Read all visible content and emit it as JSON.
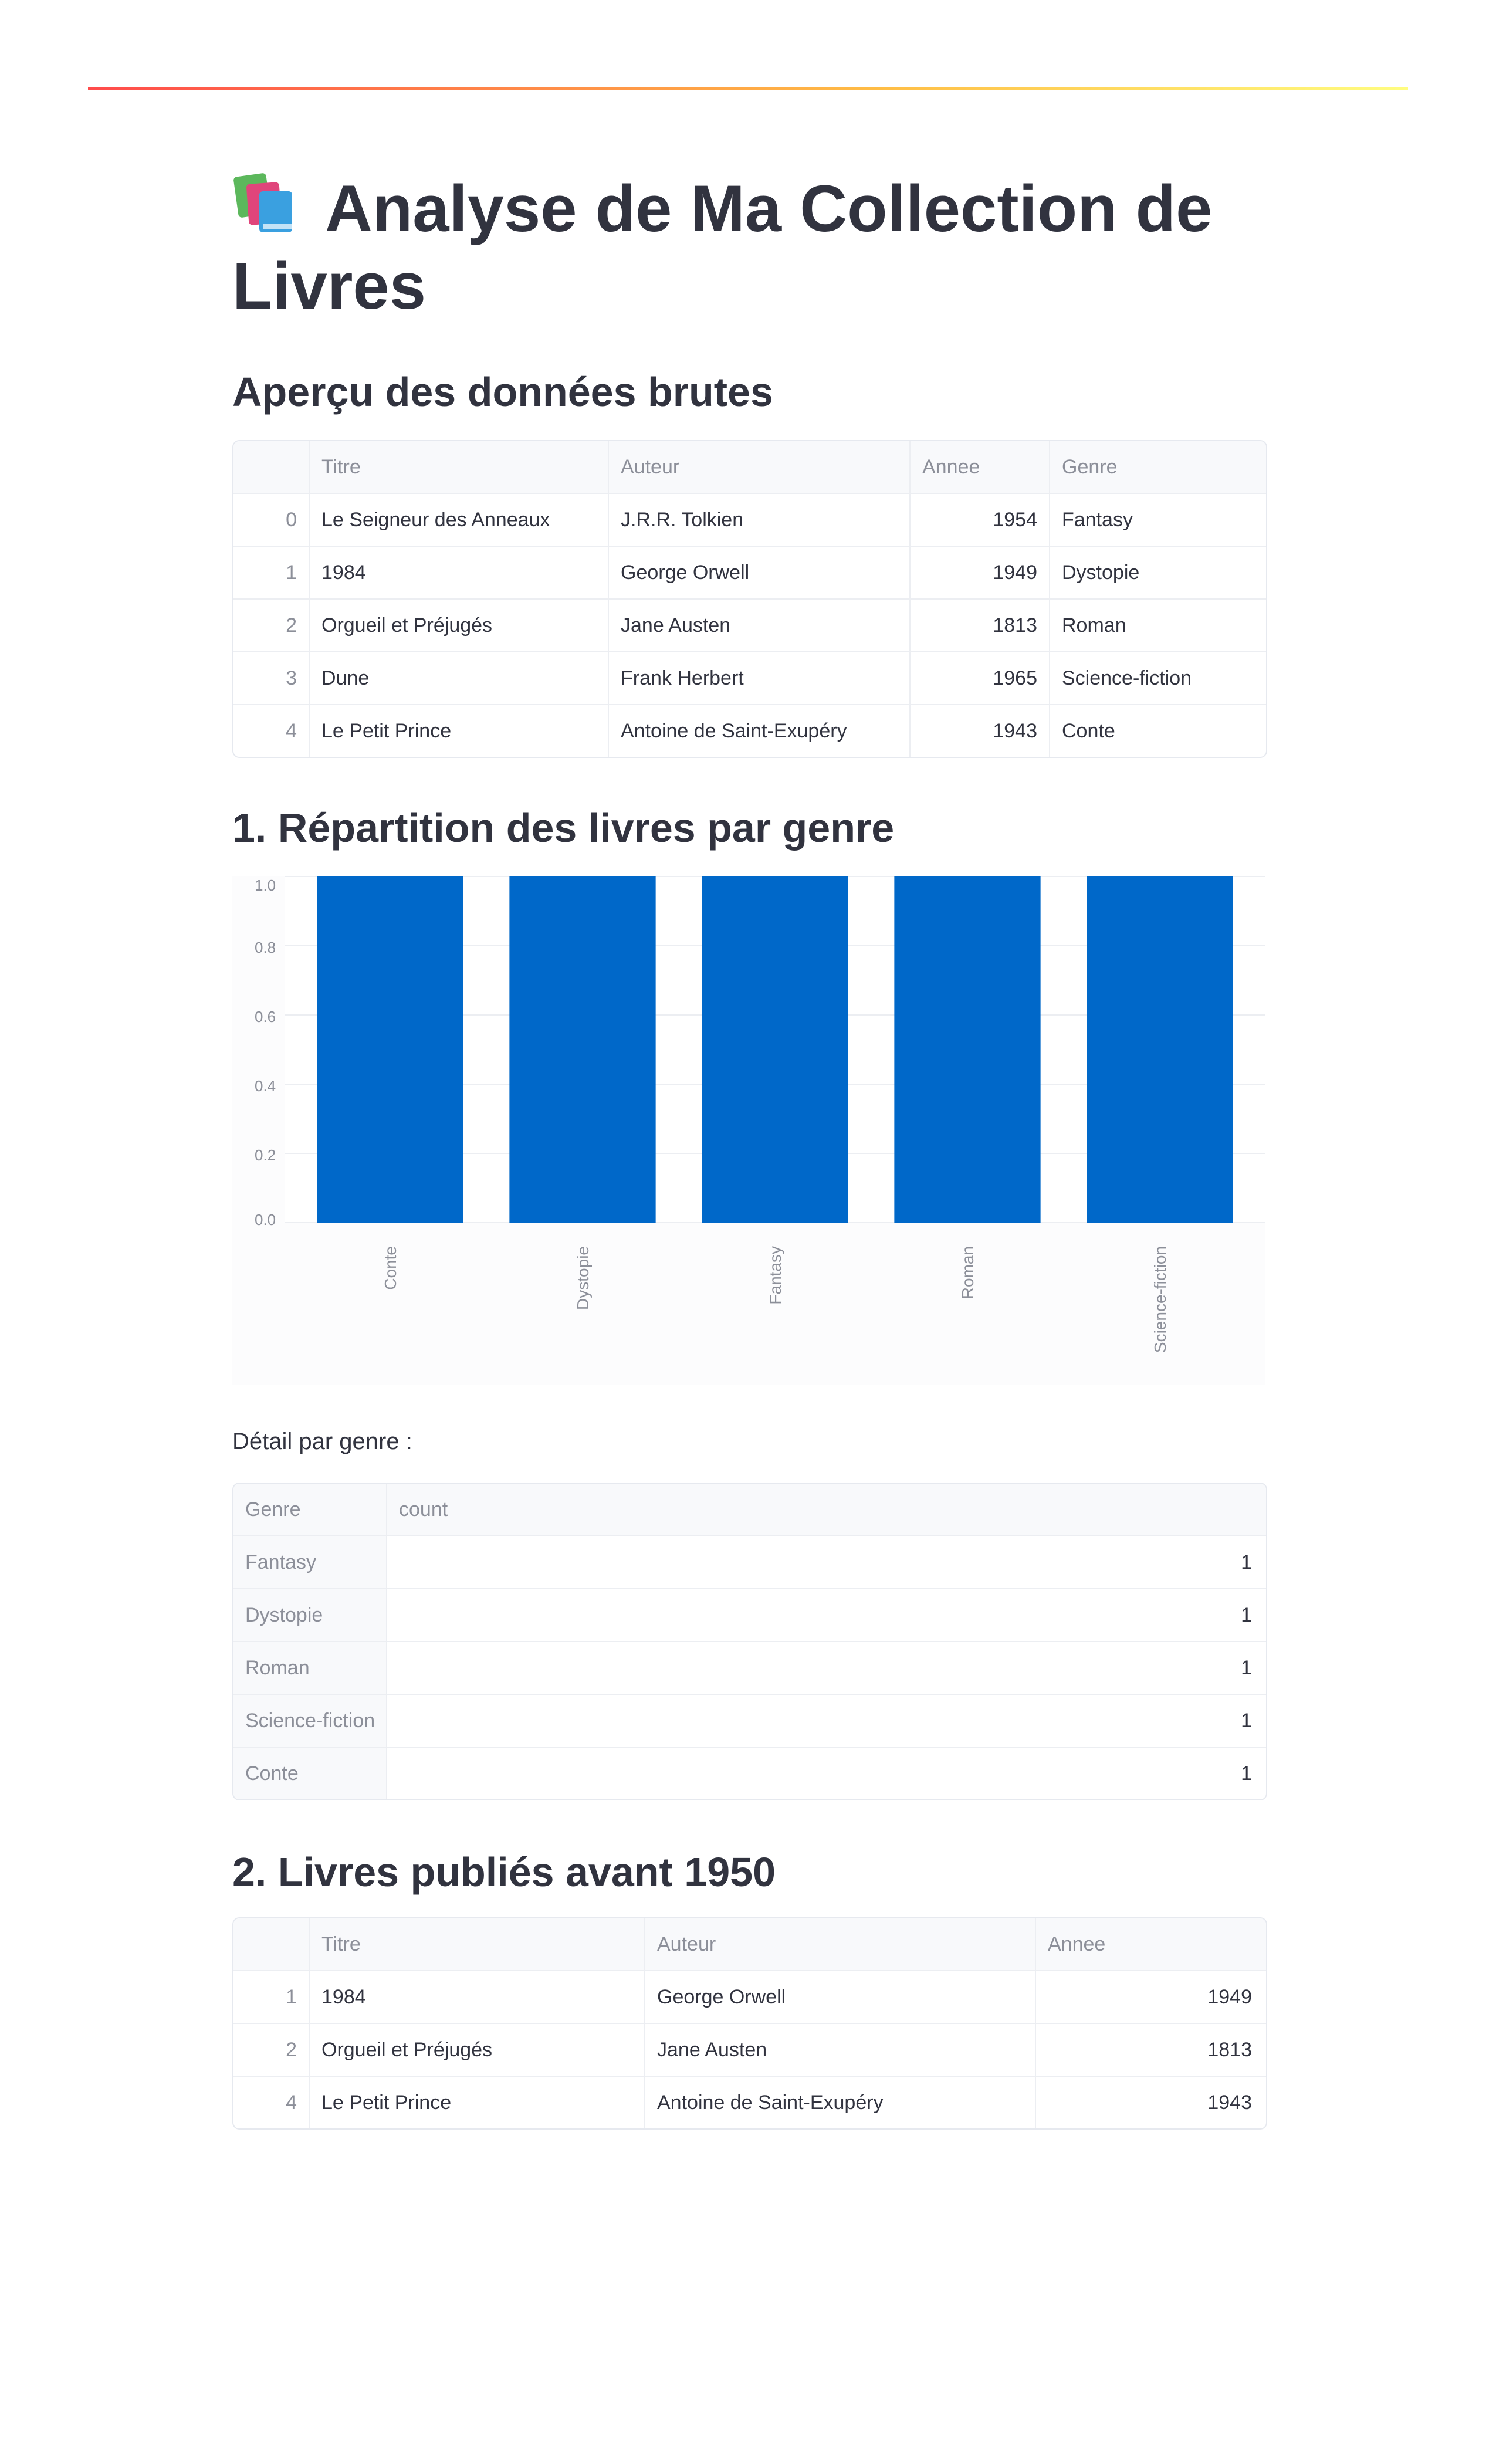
{
  "app": {
    "title": "Analyse de Ma Collection de Livres",
    "title_icon": "books-emoji-icon"
  },
  "sections": {
    "raw": "Aperçu des données brutes",
    "genre": "1. Répartition des livres par genre",
    "detail_caption": "Détail par genre :",
    "before": "2. Livres publiés avant 1950"
  },
  "raw_table": {
    "columns": [
      "",
      "Titre",
      "Auteur",
      "Annee",
      "Genre"
    ],
    "rows": [
      [
        "0",
        "Le Seigneur des Anneaux",
        "J.R.R. Tolkien",
        "1954",
        "Fantasy"
      ],
      [
        "1",
        "1984",
        "George Orwell",
        "1949",
        "Dystopie"
      ],
      [
        "2",
        "Orgueil et Préjugés",
        "Jane Austen",
        "1813",
        "Roman"
      ],
      [
        "3",
        "Dune",
        "Frank Herbert",
        "1965",
        "Science-fiction"
      ],
      [
        "4",
        "Le Petit Prince",
        "Antoine de Saint-Exupéry",
        "1943",
        "Conte"
      ]
    ]
  },
  "chart_data": {
    "type": "bar",
    "categories": [
      "Conte",
      "Dystopie",
      "Fantasy",
      "Roman",
      "Science-fiction"
    ],
    "values": [
      1,
      1,
      1,
      1,
      1
    ],
    "yticks": [
      "0.0",
      "0.2",
      "0.4",
      "0.6",
      "0.8",
      "1.0"
    ],
    "ylim": [
      0,
      1
    ],
    "grid": true,
    "bar_color": "#0068c9"
  },
  "detail_table": {
    "columns": [
      "Genre",
      "count"
    ],
    "rows": [
      [
        "Fantasy",
        "1"
      ],
      [
        "Dystopie",
        "1"
      ],
      [
        "Roman",
        "1"
      ],
      [
        "Science-fiction",
        "1"
      ],
      [
        "Conte",
        "1"
      ]
    ]
  },
  "before_table": {
    "columns": [
      "",
      "Titre",
      "Auteur",
      "Annee"
    ],
    "rows": [
      [
        "1",
        "1984",
        "George Orwell",
        "1949"
      ],
      [
        "2",
        "Orgueil et Préjugés",
        "Jane Austen",
        "1813"
      ],
      [
        "4",
        "Le Petit Prince",
        "Antoine de Saint-Exupéry",
        "1943"
      ]
    ]
  },
  "colors": {
    "accent_gradient": [
      "#ff4b4b",
      "#ffbd45",
      "#fffd80"
    ],
    "text": "#31333f",
    "muted": "#8c8f99"
  }
}
